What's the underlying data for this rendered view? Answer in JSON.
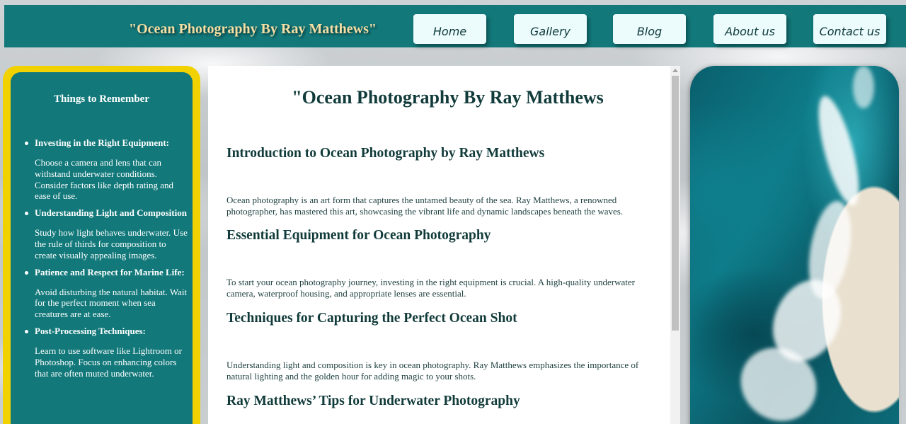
{
  "header": {
    "site_title": "\"Ocean Photography By Ray Matthews\"",
    "nav": [
      {
        "label": "Home"
      },
      {
        "label": "Gallery"
      },
      {
        "label": "Blog"
      },
      {
        "label": "About us"
      },
      {
        "label": "Contact us"
      }
    ]
  },
  "sidebar": {
    "title": "Things to Remember",
    "tips": [
      {
        "title": "Investing in the Right Equipment:",
        "body": "Choose a camera and lens that can withstand underwater conditions. Consider factors like depth rating and ease of use."
      },
      {
        "title": "Understanding Light and Composition",
        "body": "Study how light behaves underwater. Use the rule of thirds for composition to create visually appealing images."
      },
      {
        "title": "Patience and Respect for Marine Life:",
        "body": "Avoid disturbing the natural habitat. Wait for the perfect moment when sea creatures are at ease."
      },
      {
        "title": "Post-Processing Techniques:",
        "body": "Learn to use software like Lightroom or Photoshop. Focus on enhancing colors that are often muted underwater."
      }
    ]
  },
  "main": {
    "title": "\"Ocean Photography By Ray Matthews",
    "sections": [
      {
        "heading": "Introduction to Ocean Photography by Ray Matthews",
        "text": "Ocean photography is an art form that captures the untamed beauty of the sea. Ray Matthews, a renowned photographer, has mastered this art, showcasing the vibrant life and dynamic landscapes beneath the waves."
      },
      {
        "heading": "Essential Equipment for Ocean Photography",
        "text": "To start your ocean photography journey, investing in the right equipment is crucial. A high-quality underwater camera, waterproof housing, and appropriate lenses are essential."
      },
      {
        "heading": "Techniques for Capturing the Perfect Ocean Shot",
        "text": "Understanding light and composition is key in ocean photography. Ray Matthews emphasizes the importance of natural lighting and the golden hour for adding magic to your shots."
      },
      {
        "heading": "Ray Matthews’ Tips for Underwater Photography",
        "text": ""
      }
    ]
  }
}
